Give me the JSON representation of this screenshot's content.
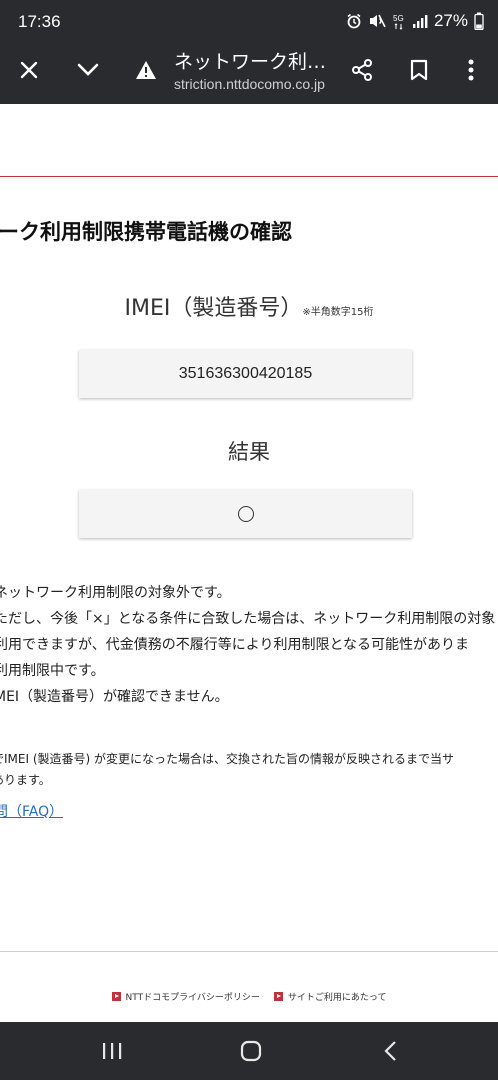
{
  "status_bar": {
    "time": "17:36",
    "network": "5G",
    "battery": "27%",
    "icons": [
      "alarm-icon",
      "mute-icon",
      "5g-icon",
      "signal-icon",
      "battery-icon"
    ]
  },
  "browser": {
    "title": "ネットワーク利用...",
    "url": "striction.nttdocomo.co.jp",
    "icons": [
      "close-icon",
      "chevron-down-icon",
      "warning-icon",
      "share-icon",
      "bookmark-icon",
      "more-icon"
    ]
  },
  "page": {
    "heading": "ーク利用制限携帯電話機の確認",
    "imei_label": "IMEI（製造番号）",
    "imei_note": "※半角数字15桁",
    "imei_value": "351636300420185",
    "result_label": "結果",
    "result_value": "◯",
    "legend": [
      "ネットワーク利用制限の対象外です。",
      "ただし、今後「×」となる条件に合致した場合は、ネットワーク利用制限の対象とな",
      "利用できますが、代金債務の不履行等により利用制限となる可能性がありま",
      "利用制限中です。",
      "MEI（製造番号）が確認できません。"
    ],
    "notes": [
      "でIMEI (製造番号) が変更になった場合は、交換された旨の情報が反映されるまで当サ",
      "あります。"
    ],
    "faq_link": "問（FAQ）"
  },
  "footer": {
    "links": [
      "NTTドコモプライバシーポリシー",
      "サイトご利用にあたって"
    ]
  },
  "nav_bar": {
    "icons": [
      "recents-icon",
      "home-icon",
      "back-icon"
    ]
  },
  "colors": {
    "toolbar_bg": "#2a2b2e",
    "accent_red": "#c0313b",
    "link_blue": "#2a6dc0",
    "box_bg": "#f4f4f4"
  }
}
